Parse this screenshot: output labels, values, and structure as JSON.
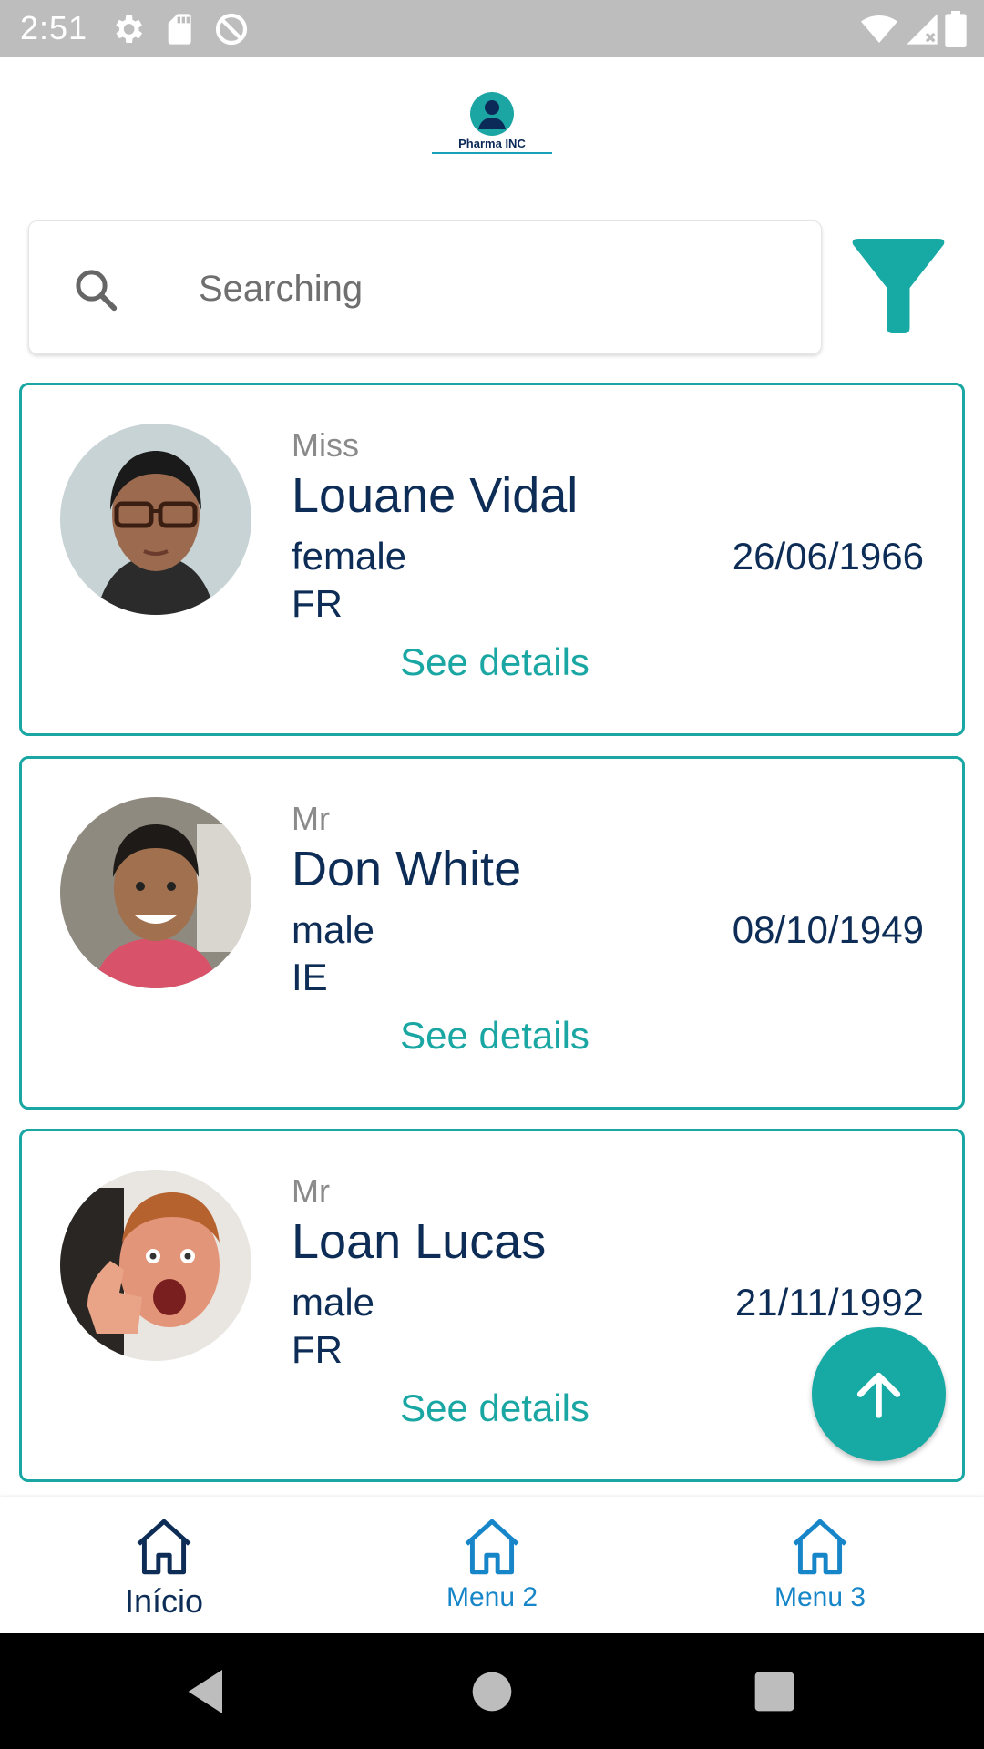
{
  "status_bar": {
    "time": "2:51",
    "left_icons": [
      "settings-icon",
      "sd-card-icon",
      "sync-blocked-icon"
    ],
    "right_icons": [
      "wifi-icon",
      "signal-icon",
      "battery-icon"
    ]
  },
  "app": {
    "logo_text": "Pharma INC"
  },
  "search": {
    "placeholder": "Searching",
    "value": ""
  },
  "patients": [
    {
      "title": "Miss",
      "name": "Louane Vidal",
      "gender": "female",
      "country": "FR",
      "dob": "26/06/1966",
      "details_label": "See details"
    },
    {
      "title": "Mr",
      "name": "Don White",
      "gender": "male",
      "country": "IE",
      "dob": "08/10/1949",
      "details_label": "See details"
    },
    {
      "title": "Mr",
      "name": "Loan Lucas",
      "gender": "male",
      "country": "FR",
      "dob": "21/11/1992",
      "details_label": "See details"
    }
  ],
  "bottom_nav": {
    "items": [
      {
        "label": "Início",
        "icon": "home-icon",
        "active": true
      },
      {
        "label": "Menu 2",
        "icon": "home-icon",
        "active": false
      },
      {
        "label": "Menu 3",
        "icon": "home-icon",
        "active": false
      }
    ]
  },
  "colors": {
    "accent": "#1aa7a3",
    "text_dark": "#0d2d57",
    "nav_inactive": "#1786c9",
    "status_bar": "#bdbdbd"
  }
}
